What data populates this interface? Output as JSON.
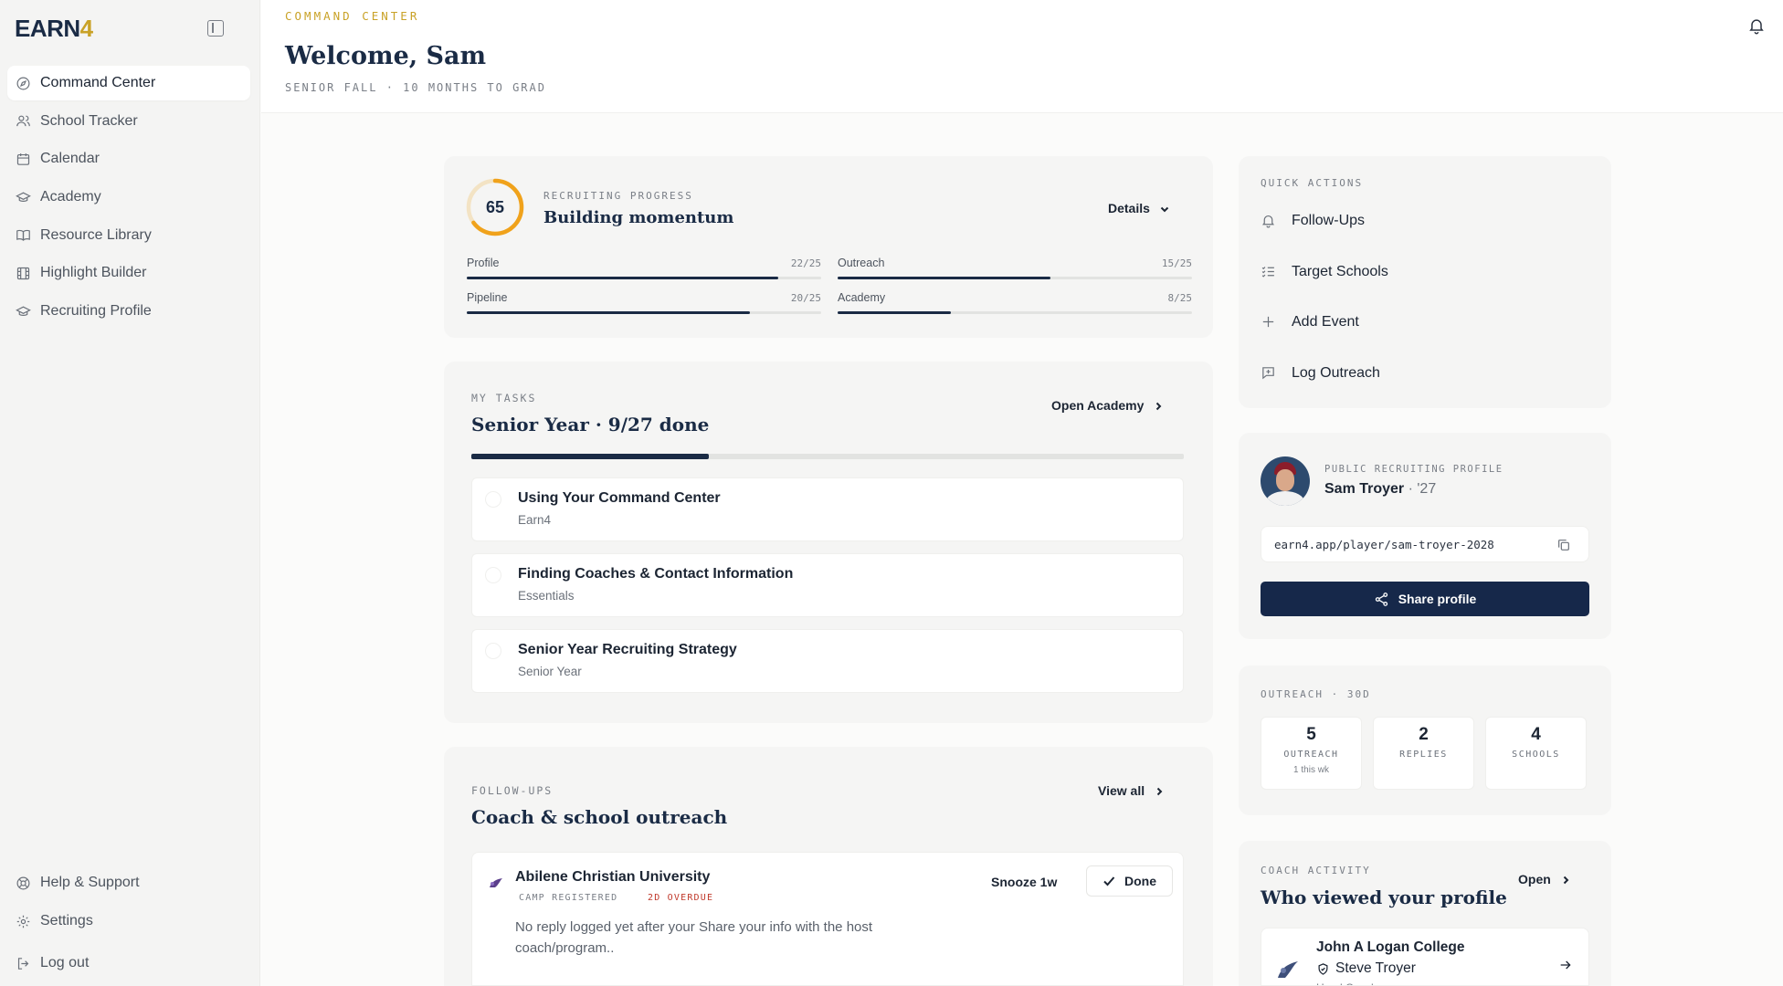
{
  "sidebar": {
    "logo_text": "EARN",
    "logo_accent": "4",
    "nav": [
      {
        "label": "Command Center"
      },
      {
        "label": "School Tracker"
      },
      {
        "label": "Calendar"
      },
      {
        "label": "Academy"
      },
      {
        "label": "Resource Library"
      },
      {
        "label": "Highlight Builder"
      },
      {
        "label": "Recruiting Profile"
      }
    ],
    "bottom": [
      {
        "label": "Help & Support"
      },
      {
        "label": "Settings"
      },
      {
        "label": "Log out"
      }
    ]
  },
  "header": {
    "eyebrow": "COMMAND CENTER",
    "title": "Welcome, Sam",
    "subline": "SENIOR FALL · 10 MONTHS TO GRAD"
  },
  "progress": {
    "score": "65",
    "score_fraction": 0.65,
    "label": "RECRUITING PROGRESS",
    "status": "Building momentum",
    "details_label": "Details",
    "bars": [
      {
        "label": "Profile",
        "value": "22/25",
        "fraction": 0.88
      },
      {
        "label": "Outreach",
        "value": "15/25",
        "fraction": 0.6
      },
      {
        "label": "Pipeline",
        "value": "20/25",
        "fraction": 0.8
      },
      {
        "label": "Academy",
        "value": "8/25",
        "fraction": 0.32
      }
    ]
  },
  "tasks": {
    "label": "MY TASKS",
    "title": "Senior Year · 9/27 done",
    "open_label": "Open Academy",
    "progress_fraction": 0.333,
    "items": [
      {
        "title": "Using Your Command Center",
        "sub": "Earn4"
      },
      {
        "title": "Finding Coaches & Contact Information",
        "sub": "Essentials"
      },
      {
        "title": "Senior Year Recruiting Strategy",
        "sub": "Senior Year"
      }
    ]
  },
  "followups": {
    "label": "FOLLOW-UPS",
    "title": "Coach & school outreach",
    "view_all": "View all",
    "item": {
      "school": "Abilene Christian University",
      "tag1": "CAMP REGISTERED",
      "tag2": "2D OVERDUE",
      "desc": "No reply logged yet after your Share your info with the host coach/program..",
      "snooze": "Snooze 1w",
      "done": "Done"
    }
  },
  "quick_actions": {
    "label": "QUICK ACTIONS",
    "items": [
      {
        "label": "Follow-Ups"
      },
      {
        "label": "Target Schools"
      },
      {
        "label": "Add Event"
      },
      {
        "label": "Log Outreach"
      }
    ]
  },
  "profile": {
    "label": "PUBLIC RECRUITING PROFILE",
    "name": "Sam Troyer",
    "year": " · '27",
    "url": "earn4.app/player/sam-troyer-2028",
    "share": "Share profile"
  },
  "outreach": {
    "label": "OUTREACH · 30D",
    "stats": [
      {
        "num": "5",
        "label": "OUTREACH",
        "sub": "1 this wk"
      },
      {
        "num": "2",
        "label": "REPLIES",
        "sub": ""
      },
      {
        "num": "4",
        "label": "SCHOOLS",
        "sub": ""
      }
    ]
  },
  "coach_activity": {
    "label": "COACH ACTIVITY",
    "title": "Who viewed your profile",
    "open": "Open",
    "item": {
      "college": "John A Logan College",
      "coach": "Steve Troyer",
      "role": "Head Coach"
    }
  },
  "colors": {
    "accent": "#c9a227",
    "navy": "#16284a",
    "ring": "#f0a21b",
    "overdue": "#c0392b"
  }
}
